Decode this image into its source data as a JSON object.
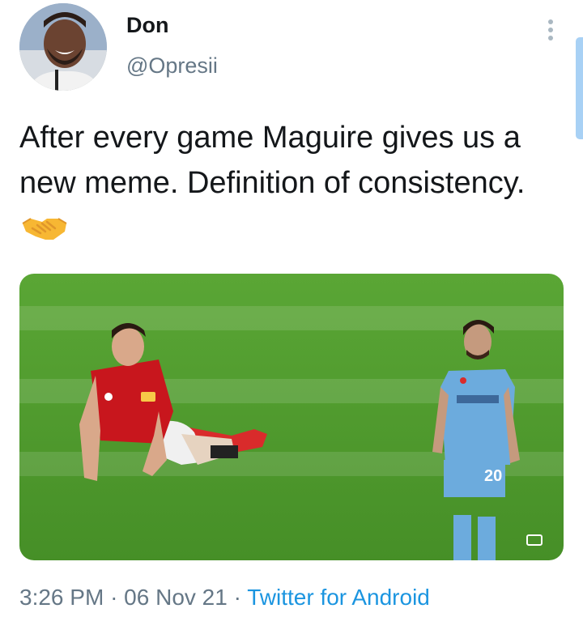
{
  "author": {
    "display_name": "Don",
    "handle": "@Opresii"
  },
  "tweet": {
    "text": "After every game Maguire gives us a new meme. Definition of consistency.",
    "emoji_icon": "handshake-icon"
  },
  "meta": {
    "time": "3:26 PM",
    "separator": "·",
    "date": "06 Nov 21",
    "source": "Twitter for Android"
  },
  "media": {
    "jersey_number": "20"
  },
  "colors": {
    "text": "#14171a",
    "secondary": "#657786",
    "link": "#1b95e0",
    "pitch": "#4e9a2c"
  },
  "icons": [
    "more-vertical-icon",
    "handshake-icon",
    "expand-icon"
  ]
}
